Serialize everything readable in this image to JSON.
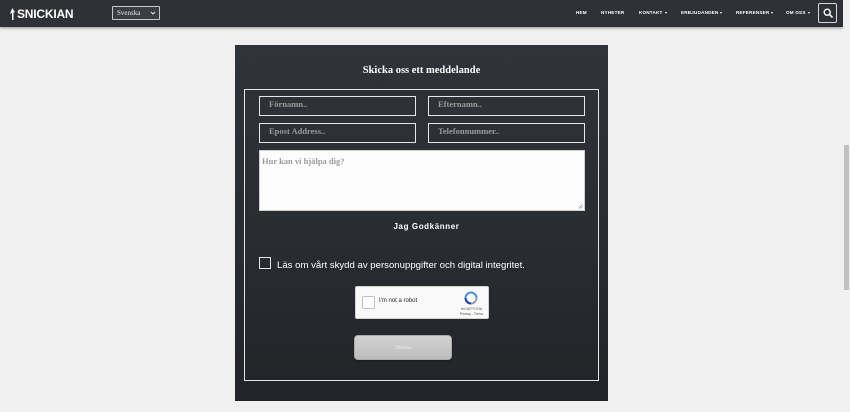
{
  "header": {
    "logo": "SNICKIAN",
    "language": "Svenska",
    "nav": [
      {
        "label": "HEM",
        "dropdown": false
      },
      {
        "label": "NYHETER",
        "dropdown": false
      },
      {
        "label": "KONTAKT",
        "dropdown": true
      },
      {
        "label": "ERBJUDANDEN",
        "dropdown": true
      },
      {
        "label": "REFERENSER",
        "dropdown": true
      },
      {
        "label": "OM OSS",
        "dropdown": true
      }
    ],
    "search_icon": "search-icon"
  },
  "form": {
    "title": "Skicka oss ett meddelande",
    "first_name_placeholder": "Förnamn..",
    "last_name_placeholder": "Efternamn..",
    "email_placeholder": "Epost Address..",
    "phone_placeholder": "Telefonnummer..",
    "message_placeholder": "Hur kan vi hjälpa dig?",
    "agree_heading": "Jag Godkänner",
    "privacy_label": "Läs om vårt skydd av personuppgifter och digital integritet.",
    "recaptcha": {
      "label": "I'm not a robot",
      "brand": "reCAPTCHA",
      "links": "Privacy - Terms"
    },
    "submit_label": "Skicka"
  }
}
